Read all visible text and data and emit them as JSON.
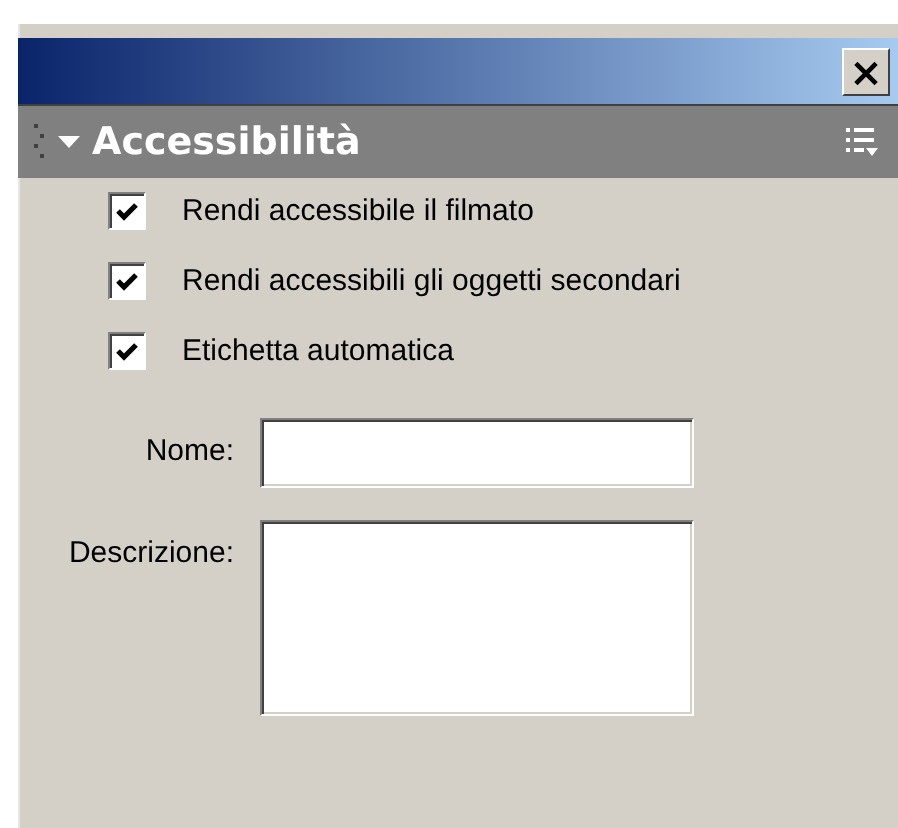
{
  "window": {
    "close": "×"
  },
  "panel": {
    "title": "Accessibilità",
    "expanded": true
  },
  "options": [
    {
      "label": "Rendi accessibile il filmato",
      "checked": true
    },
    {
      "label": "Rendi accessibili gli oggetti secondari",
      "checked": true
    },
    {
      "label": "Etichetta automatica",
      "checked": true
    }
  ],
  "fields": [
    {
      "label": "Nome:",
      "kind": "line"
    },
    {
      "label": "Descrizione:",
      "kind": "area"
    }
  ]
}
